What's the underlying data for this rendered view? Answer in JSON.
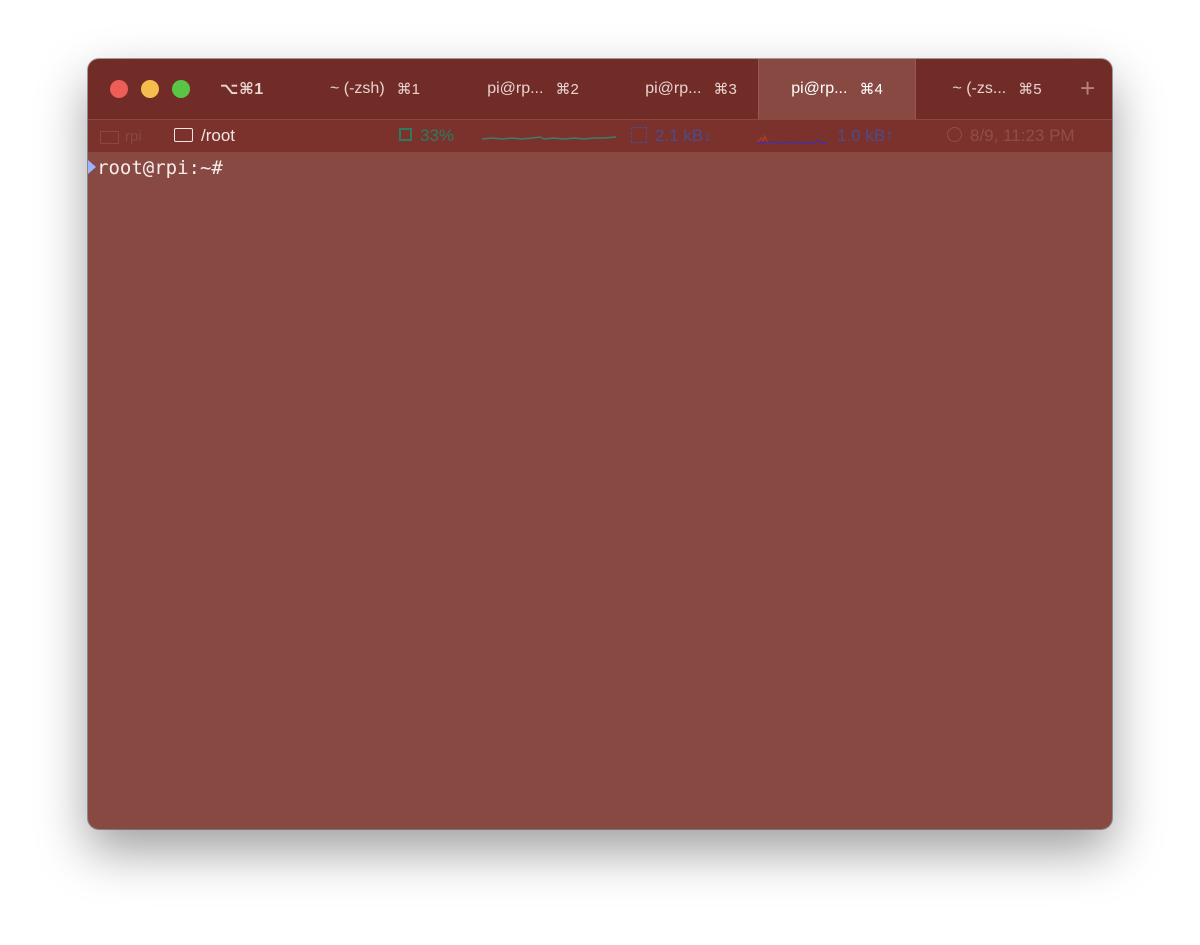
{
  "window": {
    "shortcut": "⌥⌘1",
    "background": "#884943",
    "titlebar_color": "#712c27"
  },
  "tabs": [
    {
      "title": "~ (-zsh)",
      "shortcut": "⌘1",
      "active": false
    },
    {
      "title": "pi@rp...",
      "shortcut": "⌘2",
      "active": false
    },
    {
      "title": "pi@rp...",
      "shortcut": "⌘3",
      "active": false
    },
    {
      "title": "pi@rp...",
      "shortcut": "⌘4",
      "active": true
    },
    {
      "title": "~ (-zs...",
      "shortcut": "⌘5",
      "active": false
    }
  ],
  "new_tab_label": "+",
  "status_bar": {
    "host": "rpi",
    "directory": "/root",
    "cpu": "33%",
    "network_down": "2.1 kB↓",
    "network_up": "1.0 kB↑",
    "clock": "8/9, 11:23 PM",
    "icons": [
      "host-icon",
      "folder-icon",
      "cpu-chip-icon",
      "network-icon",
      "clock-icon"
    ]
  },
  "terminal": {
    "prompt": "root@rpi:~#",
    "marker_color": "#9db5ff"
  }
}
